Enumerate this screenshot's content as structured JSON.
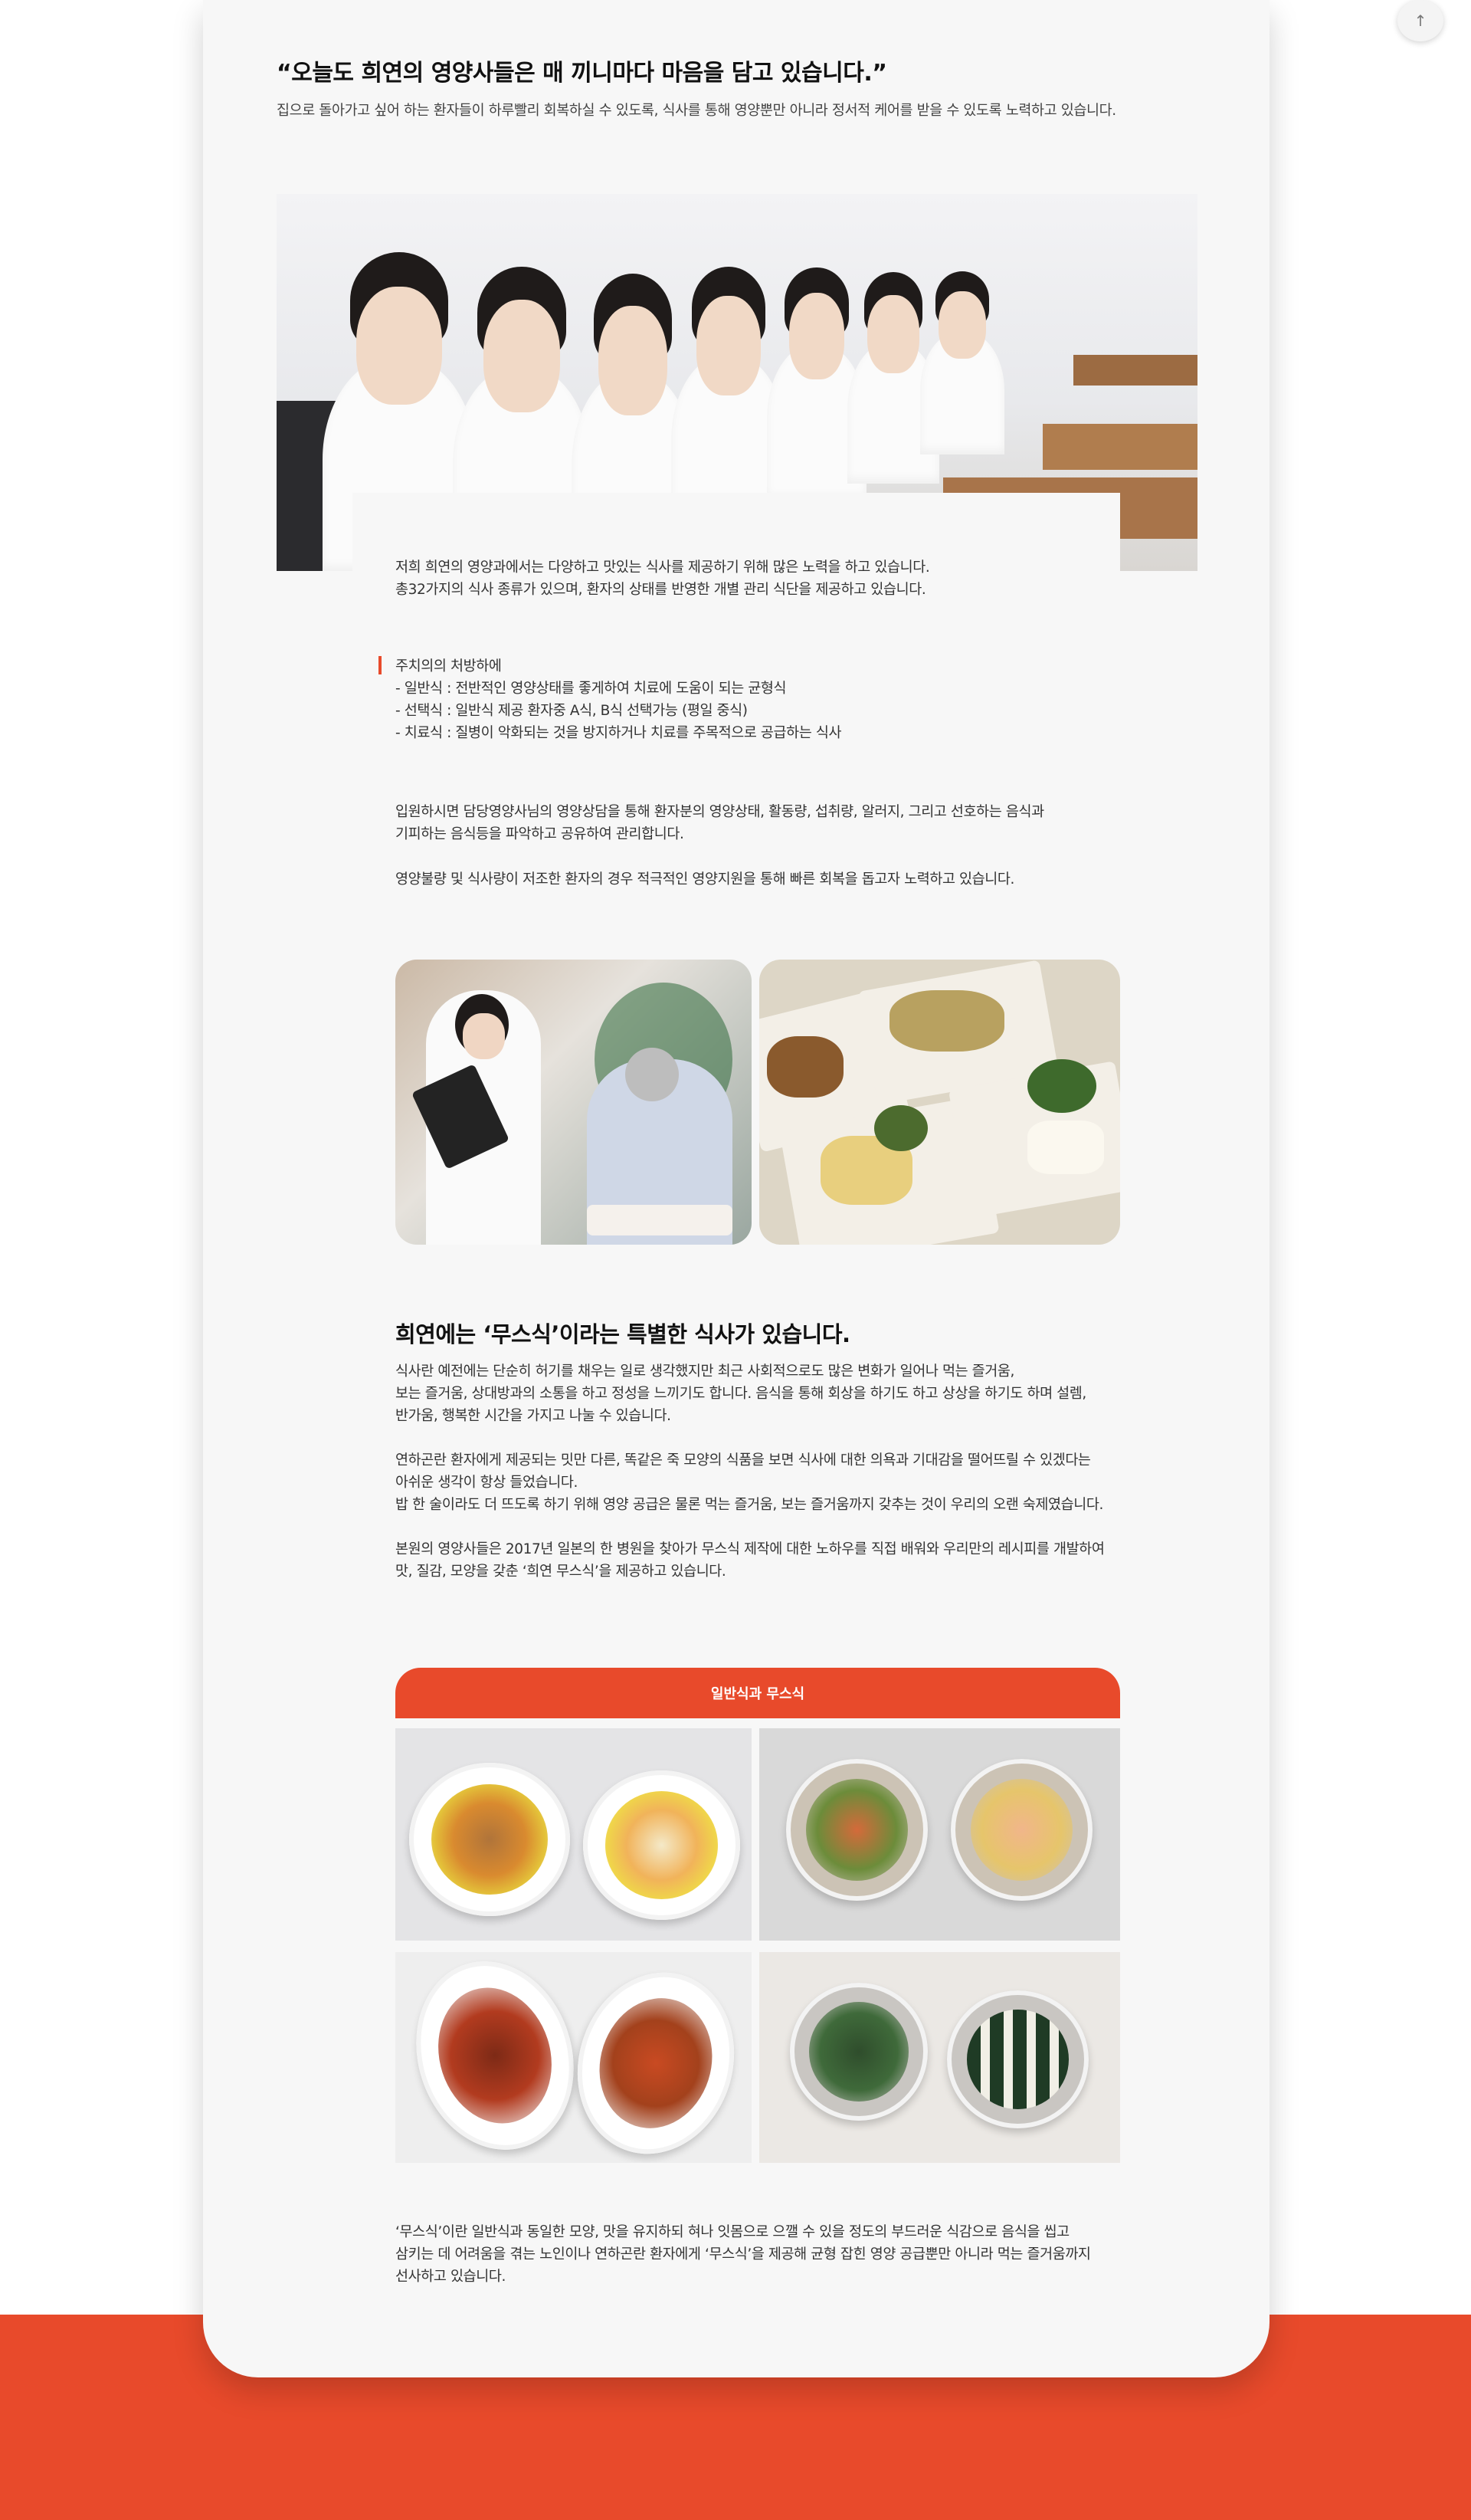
{
  "colors": {
    "accent": "#e84a2b",
    "card_bg": "#f7f7f7",
    "text": "#333333"
  },
  "top_button": {
    "icon": "arrow-up-icon",
    "glyph": "↑"
  },
  "intro": {
    "title": "“오늘도 희연의 영양사들은 매 끼니마다 마음을 담고 있습니다.”",
    "subtitle": "집으로 돌아가고 싶어 하는 환자들이 하루빨리 회복하실 수 있도록, 식사를 통해 영양뿐만 아니라 정서적 케어를 받을 수 있도록 노력하고 있습니다."
  },
  "nutrition": {
    "line1": "저희 희연의 영양과에서는 다양하고 맛있는 식사를 제공하기 위해 많은 노력을 하고 있습니다.",
    "line2": "총32가지의 식사 종류가 있으며, 환자의 상태를 반영한 개별 관리 식단을 제공하고 있습니다.",
    "prescription_heading": "주치의의 처방하에",
    "diets": [
      "- 일반식 : 전반적인 영양상태를 좋게하여 치료에 도움이 되는 균형식",
      "- 선택식 : 일반식 제공 환자중 A식, B식 선택가능 (평일 중식)",
      "- 치료식 : 질병이 악화되는 것을 방지하거나 치료를 주목적으로 공급하는 식사"
    ],
    "counsel_1": "입원하시면 담당영양사님의 영양상담을 통해 환자분의 영양상태, 활동량, 섭취량, 알러지, 그리고 선호하는 음식과\n기피하는 음식등을 파악하고 공유하여 관리합니다.",
    "counsel_2": "영양불량 및 식사량이 저조한 환자의 경우 적극적인 영양지원을 통해 빠른 회복을 돕고자 노력하고 있습니다."
  },
  "musik": {
    "title": "희연에는 ‘무스식’이라는 특별한 식사가 있습니다.",
    "para1": "식사란 예전에는 단순히 허기를 채우는 일로 생각했지만 최근 사회적으로도 많은 변화가 일어나 먹는 즐거움,\n보는 즐거움, 상대방과의 소통을 하고 정성을 느끼기도 합니다. 음식을 통해 회상을 하기도 하고 상상을 하기도 하며 설렘,\n반가움, 행복한 시간을 가지고 나눌 수 있습니다.",
    "para2": "연하곤란 환자에게 제공되는 밋만 다른, 똑같은 죽 모양의 식품을 보면 식사에 대한 의욕과 기대감을 떨어뜨릴 수 있겠다는\n아쉬운 생각이 항상 들었습니다.\n밥 한 술이라도 더 뜨도록 하기 위해 영양 공급은 물론 먹는 즐거움, 보는 즐거움까지 갖추는 것이 우리의 오랜 숙제였습니다.",
    "para3": "본원의 영양사들은 2017년 일본의 한 병원을 찾아가 무스식 제작에 대한 노하우를 직접 배워와 우리만의 레시피를 개발하여\n맛, 질감, 모양을 갖춘 ‘희연 무스식’을 제공하고 있습니다.",
    "compare_tab": "일반식과 무스식",
    "closing": "‘무스식’이란 일반식과 동일한 모양, 맛을 유지하되 혀나 잇몸으로 으깰 수 있을 정도의 부드러운 식감으로 음식을 씹고\n삼키는 데 어려움을 겪는 노인이나 연하곤란 환자에게 ‘무스식’을 제공해 균형 잡힌 영양 공급뿐만 아니라 먹는 즐거움까지\n선사하고 있습니다."
  }
}
